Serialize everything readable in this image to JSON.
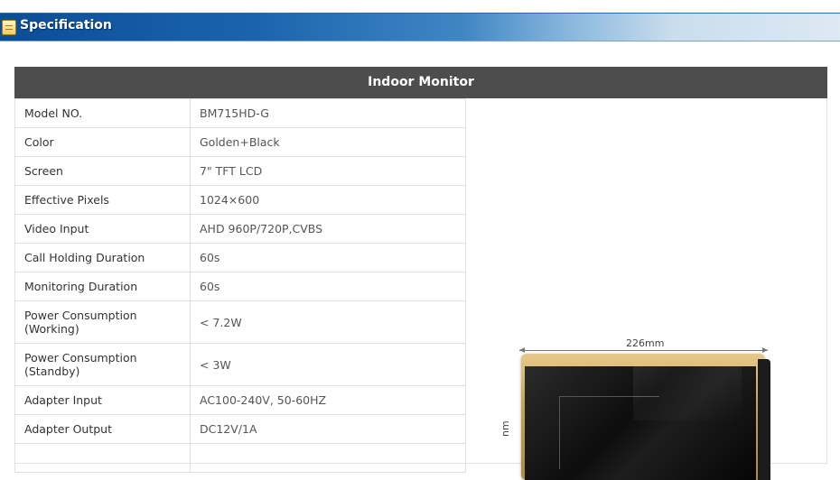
{
  "header": {
    "title": "Specification",
    "icon": "table-icon"
  },
  "panel": {
    "title": "Indoor Monitor"
  },
  "specs": [
    {
      "label": "Model NO.",
      "value": "BM715HD-G"
    },
    {
      "label": "Color",
      "value": "Golden+Black"
    },
    {
      "label": "Screen",
      "value": "7\" TFT LCD"
    },
    {
      "label": "Effective Pixels",
      "value": "1024×600"
    },
    {
      "label": "Video Input",
      "value": "AHD 960P/720P,CVBS"
    },
    {
      "label": "Call Holding Duration",
      "value": "60s"
    },
    {
      "label": "Monitoring Duration",
      "value": "60s"
    },
    {
      "label": "Power Consumption (Working)",
      "value": "< 7.2W"
    },
    {
      "label": "Power Consumption (Standby)",
      "value": "< 3W"
    },
    {
      "label": "Adapter Input",
      "value": "AC100-240V, 50-60HZ"
    },
    {
      "label": "Adapter Output",
      "value": "DC12V/1A"
    },
    {
      "label": "",
      "value": ""
    }
  ],
  "product_image": {
    "width_label": "226mm",
    "height_label_partial": "nm"
  },
  "colors": {
    "header_blue": "#1a64ad",
    "panel_title_bg": "#4d4d4d",
    "device_gold": "#c9a456"
  }
}
